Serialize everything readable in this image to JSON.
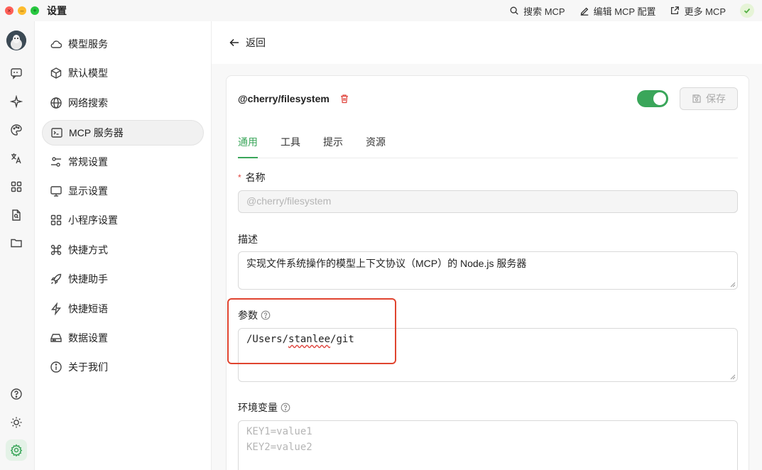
{
  "window": {
    "title": "设置"
  },
  "title_actions": [
    {
      "label": "搜索 MCP",
      "icon": "search-icon"
    },
    {
      "label": "编辑 MCP 配置",
      "icon": "edit-icon"
    },
    {
      "label": "更多 MCP",
      "icon": "external-link-icon"
    }
  ],
  "nav": {
    "items": [
      {
        "label": "模型服务",
        "icon": "cloud-icon"
      },
      {
        "label": "默认模型",
        "icon": "cube-icon"
      },
      {
        "label": "网络搜索",
        "icon": "globe-icon"
      },
      {
        "label": "MCP 服务器",
        "icon": "terminal-icon",
        "active": true
      },
      {
        "label": "常规设置",
        "icon": "sliders-icon"
      },
      {
        "label": "显示设置",
        "icon": "monitor-icon"
      },
      {
        "label": "小程序设置",
        "icon": "grid-icon"
      },
      {
        "label": "快捷方式",
        "icon": "command-icon"
      },
      {
        "label": "快捷助手",
        "icon": "rocket-icon"
      },
      {
        "label": "快捷短语",
        "icon": "zap-icon"
      },
      {
        "label": "数据设置",
        "icon": "hard-drive-icon"
      },
      {
        "label": "关于我们",
        "icon": "info-icon"
      }
    ]
  },
  "main": {
    "back_label": "返回",
    "server": {
      "name": "@cherry/filesystem",
      "enabled": true,
      "save_label": "保存"
    },
    "tabs": [
      {
        "label": "通用",
        "active": true
      },
      {
        "label": "工具"
      },
      {
        "label": "提示"
      },
      {
        "label": "资源"
      }
    ],
    "fields": {
      "name": {
        "label": "名称",
        "required_mark": "*",
        "value": "@cherry/filesystem"
      },
      "description": {
        "label": "描述",
        "value": "实现文件系统操作的模型上下文协议（MCP）的 Node.js 服务器"
      },
      "args": {
        "label": "参数",
        "value_prefix": "/Users/",
        "value_underlined": "stanlee",
        "value_suffix": "/git"
      },
      "env": {
        "label": "环境变量",
        "placeholder_line1": "KEY1=value1",
        "placeholder_line2": "KEY2=value2"
      }
    }
  },
  "colors": {
    "accent": "#3aa65a",
    "danger": "#e0463f",
    "highlight": "#e0442f"
  }
}
